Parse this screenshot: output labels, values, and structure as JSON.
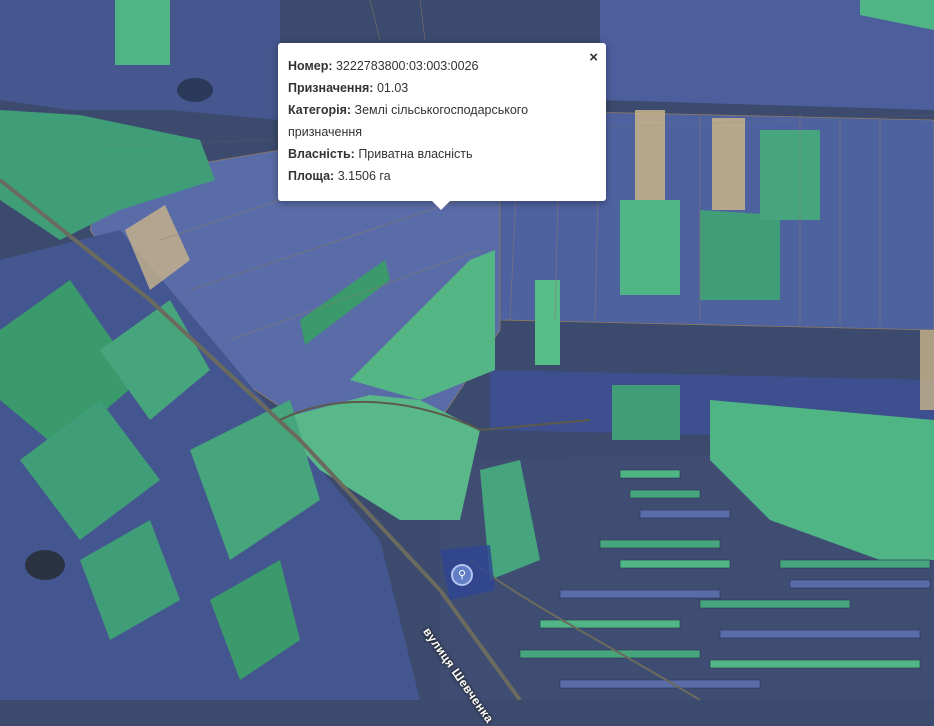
{
  "popup": {
    "fields": [
      {
        "label": "Номер:",
        "value": "3222783800:03:003:0026"
      },
      {
        "label": "Призначення:",
        "value": "01.03"
      },
      {
        "label": "Категорія:",
        "value": "Землі сільськогосподарського призначення"
      },
      {
        "label": "Власність:",
        "value": "Приватна власність"
      },
      {
        "label": "Площа:",
        "value": "3.1506 га"
      }
    ],
    "close_label": "×"
  },
  "map": {
    "street_label": "вулиця Шевченка",
    "marker_icon": "person-pin-icon",
    "colors": {
      "parcel_blue": "#4d5f9e",
      "parcel_green": "#46a57c",
      "base": "#3c4a6e",
      "sand": "#c9b48a"
    }
  }
}
